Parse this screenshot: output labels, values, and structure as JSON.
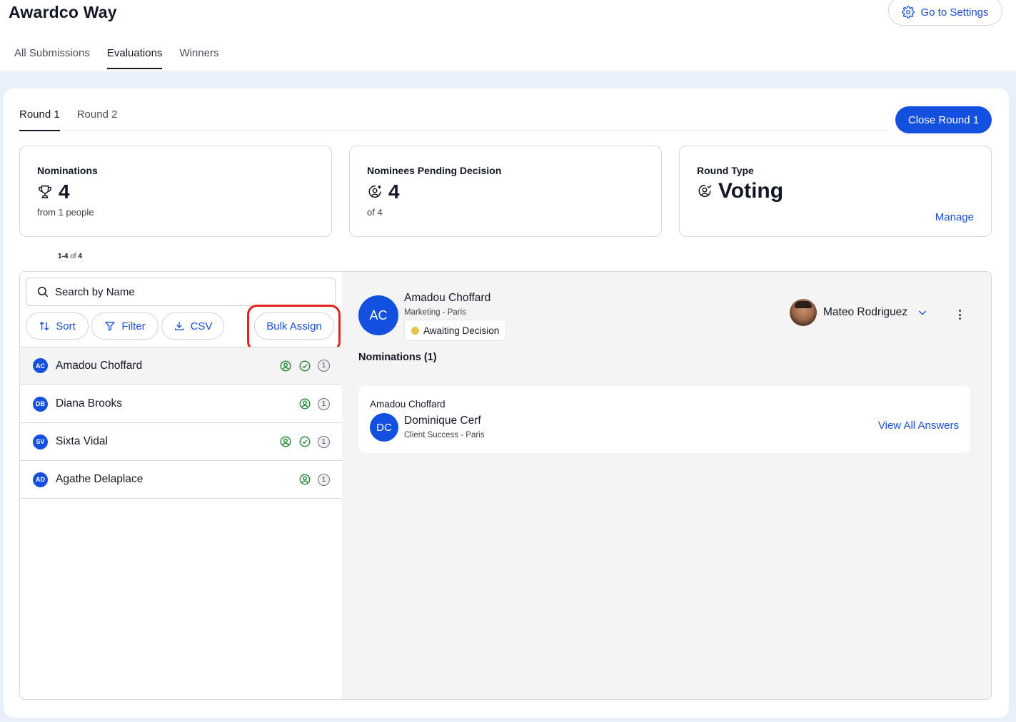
{
  "app": {
    "title": "Awardco Way",
    "settings_label": "Go to Settings"
  },
  "main_tabs": [
    {
      "label": "All Submissions",
      "active": false
    },
    {
      "label": "Evaluations",
      "active": true
    },
    {
      "label": "Winners",
      "active": false
    }
  ],
  "round_tabs": [
    {
      "label": "Round 1",
      "active": true
    },
    {
      "label": "Round 2",
      "active": false
    }
  ],
  "close_round_label": "Close Round 1",
  "stats": {
    "nominations": {
      "label": "Nominations",
      "value": "4",
      "sub": "from 1 people",
      "icon": "trophy-icon"
    },
    "pending": {
      "label": "Nominees Pending Decision",
      "value": "4",
      "sub": "of 4",
      "icon": "user-add-icon"
    },
    "round_type": {
      "label": "Round Type",
      "value": "Voting",
      "manage_label": "Manage",
      "icon": "user-check-icon"
    }
  },
  "pager": {
    "range": "1-4",
    "of": "of",
    "total": "4"
  },
  "toolbar": {
    "search_placeholder": "Search by Name",
    "sort_label": "Sort",
    "filter_label": "Filter",
    "csv_label": "CSV",
    "bulk_assign_label": "Bulk Assign"
  },
  "nominees": [
    {
      "initials": "AC",
      "name": "Amadou Choffard",
      "assigned": true,
      "approved": true,
      "count": "1",
      "selected": true
    },
    {
      "initials": "DB",
      "name": "Diana Brooks",
      "assigned": true,
      "approved": false,
      "count": "1",
      "selected": false
    },
    {
      "initials": "SV",
      "name": "Sixta Vidal",
      "assigned": true,
      "approved": true,
      "count": "1",
      "selected": false
    },
    {
      "initials": "AD",
      "name": "Agathe Delaplace",
      "assigned": true,
      "approved": false,
      "count": "1",
      "selected": false
    }
  ],
  "detail": {
    "initials": "AC",
    "name": "Amadou Choffard",
    "department": "Marketing - Paris",
    "status": "Awaiting Decision",
    "status_color": "#e8c04c",
    "assignee": "Mateo Rodriguez",
    "nominations_heading": "Nominations (1)",
    "nomination": {
      "nominee_name": "Amadou Choffard",
      "nominator_initials": "DC",
      "nominator_name": "Dominique Cerf",
      "nominator_department": "Client Success - Paris",
      "view_label": "View All Answers"
    }
  },
  "colors": {
    "accent": "#1450e0",
    "link": "#1a4fd6",
    "success": "#2e8b3e",
    "highlight": "#e0241c"
  }
}
